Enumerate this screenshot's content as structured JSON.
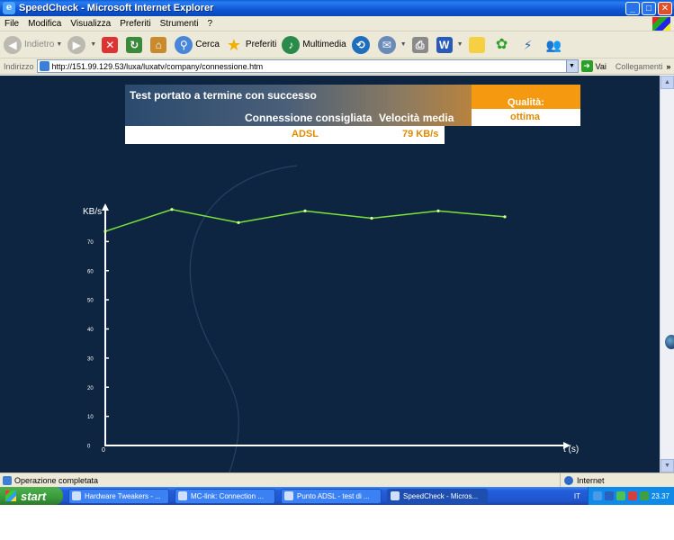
{
  "window": {
    "title": "SpeedCheck - Microsoft Internet Explorer",
    "buttons": {
      "minimize": "_",
      "maximize": "□",
      "close": "✕"
    }
  },
  "menu": [
    "File",
    "Modifica",
    "Visualizza",
    "Preferiti",
    "Strumenti",
    "?"
  ],
  "toolbar": {
    "back": "Indietro",
    "search": "Cerca",
    "favorites": "Preferiti",
    "media": "Multimedia"
  },
  "address": {
    "label": "Indirizzo",
    "url": "http://151.99.129.53/luxa/luxatv/company/connessione.htm",
    "go": "Vai",
    "links": "Collegamenti",
    "more": "»"
  },
  "result": {
    "status": "Test portato a termine con successo",
    "recommended_label": "Connessione consigliata",
    "recommended_value": "ADSL",
    "speed_label": "Velocità media",
    "speed_value": "79 KB/s",
    "quality_label": "Qualità:",
    "quality_value": "ottima"
  },
  "chart_data": {
    "type": "line",
    "ylabel": "KB/s",
    "xlabel": "t (s)",
    "ylim": [
      0,
      80
    ],
    "yticks": [
      0,
      10,
      20,
      30,
      40,
      50,
      60,
      70
    ],
    "x_tick_label": "0",
    "series": [
      {
        "values": [
          73.5,
          81,
          76.5,
          80.5,
          78,
          80.5,
          78.5
        ]
      }
    ],
    "series_color": "#7de23a",
    "grid": false
  },
  "statusbar": {
    "text": "Operazione completata",
    "zone": "Internet"
  },
  "taskbar": {
    "start": "start",
    "tasks": [
      "Hardware Tweakers - ...",
      "MC-link: Connection ...",
      "Punto ADSL - test di ...",
      "SpeedCheck - Micros..."
    ],
    "lang": "IT",
    "clock": "23.37"
  }
}
